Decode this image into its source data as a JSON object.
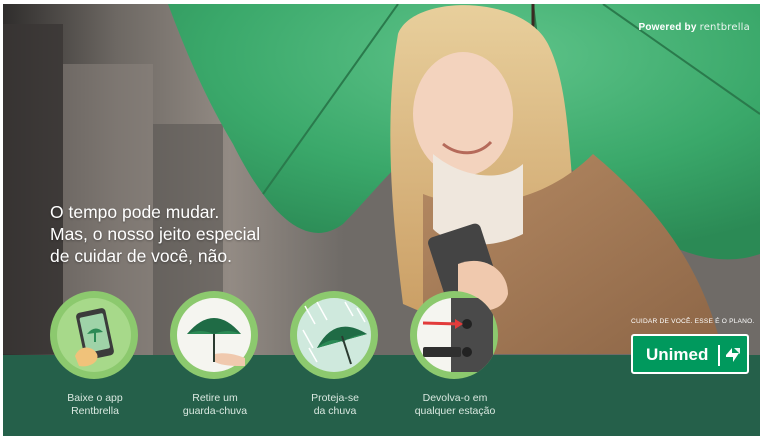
{
  "powered": {
    "prefix": "Powered by",
    "brand": "rentbrella"
  },
  "headline": {
    "line1": "O tempo pode mudar.",
    "line2": "Mas, o nosso jeito especial",
    "line3": "de cuidar de você, não."
  },
  "steps": [
    {
      "line1": "Baixe o app",
      "line2": "Rentbrella",
      "icon": "phone-umbrella-icon"
    },
    {
      "line1": "Retire um",
      "line2": "guarda-chuva",
      "icon": "hand-umbrella-icon"
    },
    {
      "line1": "Proteja-se",
      "line2": "da chuva",
      "icon": "rain-umbrella-icon"
    },
    {
      "line1": "Devolva-o em",
      "line2": "qualquer estação",
      "icon": "return-station-icon"
    }
  ],
  "brand": {
    "tagline": "CUIDAR DE VOCÊ. ESSE É O PLANO.",
    "name": "Unimed",
    "symbol": "unimed-logo-icon"
  },
  "colors": {
    "umbrella_green": "#3aa86a",
    "band": "#25604a",
    "circle": "#8cc96e",
    "unimed": "#00995d"
  }
}
